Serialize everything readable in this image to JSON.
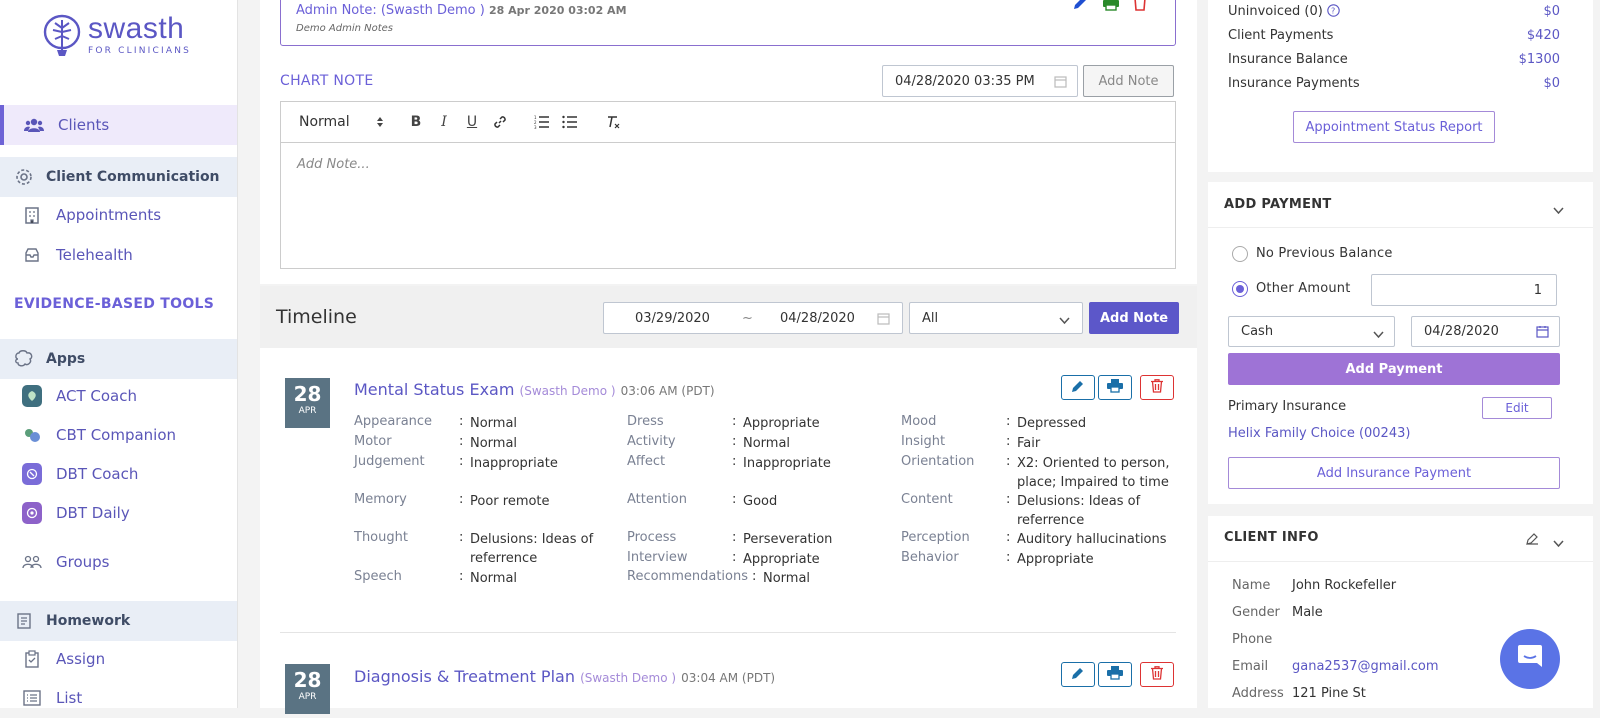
{
  "brand": {
    "name": "swasth",
    "tagline": "FOR CLINICIANS"
  },
  "sidebar": {
    "items": [
      {
        "label": "Clients"
      },
      {
        "label": "Client Communication"
      },
      {
        "label": "Appointments"
      },
      {
        "label": "Telehealth"
      }
    ],
    "section_title": "EVIDENCE-BASED TOOLS",
    "apps_group": "Apps",
    "apps": [
      {
        "label": "ACT Coach",
        "color": "#3f6f7f"
      },
      {
        "label": "CBT Companion",
        "color": "#5b9e7a"
      },
      {
        "label": "DBT Coach",
        "color": "#7a6cd8"
      },
      {
        "label": "DBT Daily",
        "color": "#8d62c9"
      }
    ],
    "groups": "Groups",
    "homework_group": "Homework",
    "homework": [
      {
        "label": "Assign"
      },
      {
        "label": "List"
      }
    ]
  },
  "admin_note": {
    "title": "Admin Note:  (Swasth Demo )",
    "date": "28 Apr 2020 03:02 AM",
    "body": "Demo Admin Notes"
  },
  "chart_note": {
    "label": "CHART NOTE",
    "datetime": "04/28/2020 03:35 PM",
    "add_button": "Add Note",
    "format_select": "Normal",
    "placeholder": "Add Note..."
  },
  "timeline": {
    "title": "Timeline",
    "from": "03/29/2020",
    "sep": "~",
    "to": "04/28/2020",
    "filter": "All",
    "add_button": "Add Note",
    "entries": [
      {
        "day": "28",
        "month": "APR",
        "title": "Mental Status Exam",
        "author": "(Swasth Demo )",
        "time": "03:06 AM (PDT)",
        "fields": {
          "col1": [
            {
              "k": "Appearance",
              "v": "Normal"
            },
            {
              "k": "Motor",
              "v": "Normal"
            },
            {
              "k": "Judgement",
              "v": "Inappropriate"
            },
            {
              "k": "Memory",
              "v": "Poor remote"
            },
            {
              "k": "Thought",
              "v": "Delusions: Ideas of referrence"
            },
            {
              "k": "Speech",
              "v": "Normal"
            }
          ],
          "col2": [
            {
              "k": "Dress",
              "v": "Appropriate"
            },
            {
              "k": "Activity",
              "v": "Normal"
            },
            {
              "k": "Affect",
              "v": "Inappropriate"
            },
            {
              "k": "Attention",
              "v": "Good"
            },
            {
              "k": "Process",
              "v": "Perseveration"
            },
            {
              "k": "Interview",
              "v": "Appropriate"
            },
            {
              "k": "Recommendations",
              "v": "Normal"
            }
          ],
          "col3": [
            {
              "k": "Mood",
              "v": "Depressed"
            },
            {
              "k": "Insight",
              "v": "Fair"
            },
            {
              "k": "Orientation",
              "v": "X2: Oriented to person, place; Impaired to time"
            },
            {
              "k": "Content",
              "v": "Delusions: Ideas of referrence"
            },
            {
              "k": "Perception",
              "v": "Auditory hallucinations"
            },
            {
              "k": "Behavior",
              "v": "Appropriate"
            }
          ]
        }
      },
      {
        "day": "28",
        "month": "APR",
        "title": "Diagnosis & Treatment Plan",
        "author": "(Swasth Demo )",
        "time": "03:04 AM (PDT)"
      }
    ]
  },
  "billing": {
    "rows": [
      {
        "label": "Uninvoiced (0)",
        "value": "$0"
      },
      {
        "label": "Client Payments",
        "value": "$420"
      },
      {
        "label": "Insurance Balance",
        "value": "$1300"
      },
      {
        "label": "Insurance Payments",
        "value": "$0"
      }
    ],
    "report_button": "Appointment Status Report"
  },
  "add_payment": {
    "title": "ADD PAYMENT",
    "option_no_prev": "No Previous Balance",
    "option_other": "Other Amount",
    "amount": "1",
    "method": "Cash",
    "date": "04/28/2020",
    "add_button": "Add Payment",
    "primary_insurance_label": "Primary Insurance",
    "edit_button": "Edit",
    "insurance_name": "Helix Family Choice (00243)",
    "add_insurance_button": "Add Insurance Payment"
  },
  "client_info": {
    "title": "CLIENT INFO",
    "rows": [
      {
        "label": "Name",
        "value": "John Rockefeller"
      },
      {
        "label": "Gender",
        "value": "Male"
      },
      {
        "label": "Phone",
        "value": ""
      },
      {
        "label": "Email",
        "value": "gana2537@gmail.com"
      },
      {
        "label": "Address",
        "value": "121 Pine St"
      }
    ]
  },
  "colors": {
    "accent": "#5c57c9",
    "brand": "#5b57c4",
    "delete": "#d33",
    "print": "#1a6fa8",
    "green": "#2a8a2a"
  }
}
